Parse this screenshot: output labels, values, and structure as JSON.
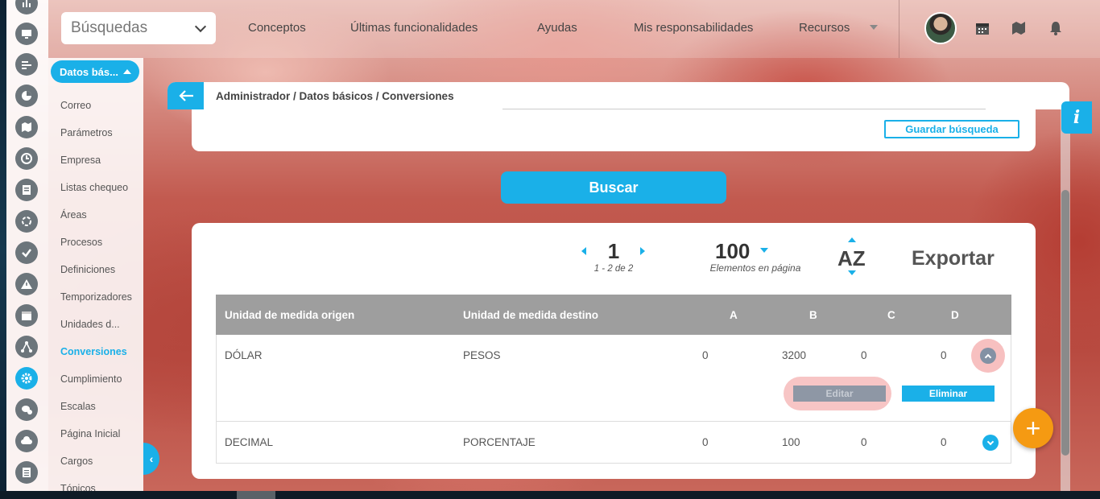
{
  "search": {
    "placeholder": "Búsquedas"
  },
  "nav": {
    "items": [
      "Conceptos",
      "Últimas funcionalidades",
      "Ayudas",
      "Mis responsabilidades",
      "Recursos"
    ]
  },
  "menu": {
    "pill_label": "Datos bás...",
    "items": [
      "Correo",
      "Parámetros",
      "Empresa",
      "Listas chequeo",
      "Áreas",
      "Procesos",
      "Definiciones",
      "Temporizadores",
      "Unidades d...",
      "Conversiones",
      "Cumplimiento",
      "Escalas",
      "Página Inicial",
      "Cargos",
      "Tópicos"
    ],
    "active": "Conversiones"
  },
  "breadcrumb": "Administrador / Datos básicos / Conversiones",
  "save_search_label": "Guardar búsqueda",
  "search_button_label": "Buscar",
  "pager": {
    "page": "1",
    "range": "1 - 2 de 2",
    "per_page": "100",
    "per_page_label": "Elementos en página",
    "sort_label": "AZ",
    "export_label": "Exportar"
  },
  "table": {
    "headers": [
      "Unidad de medida origen",
      "Unidad de medida destino",
      "A",
      "B",
      "C",
      "D"
    ],
    "rows": [
      {
        "origen": "DÓLAR",
        "destino": "PESOS",
        "a": "0",
        "b": "3200",
        "c": "0",
        "d": "0"
      },
      {
        "origen": "DECIMAL",
        "destino": "PORCENTAJE",
        "a": "0",
        "b": "100",
        "c": "0",
        "d": "0"
      }
    ],
    "edit_label": "Editar",
    "delete_label": "Eliminar"
  },
  "info_label": "i",
  "fab_label": "+",
  "colors": {
    "accent": "#1ab0e8",
    "fab": "#f59a12",
    "header_gray": "#9e9e9e"
  }
}
